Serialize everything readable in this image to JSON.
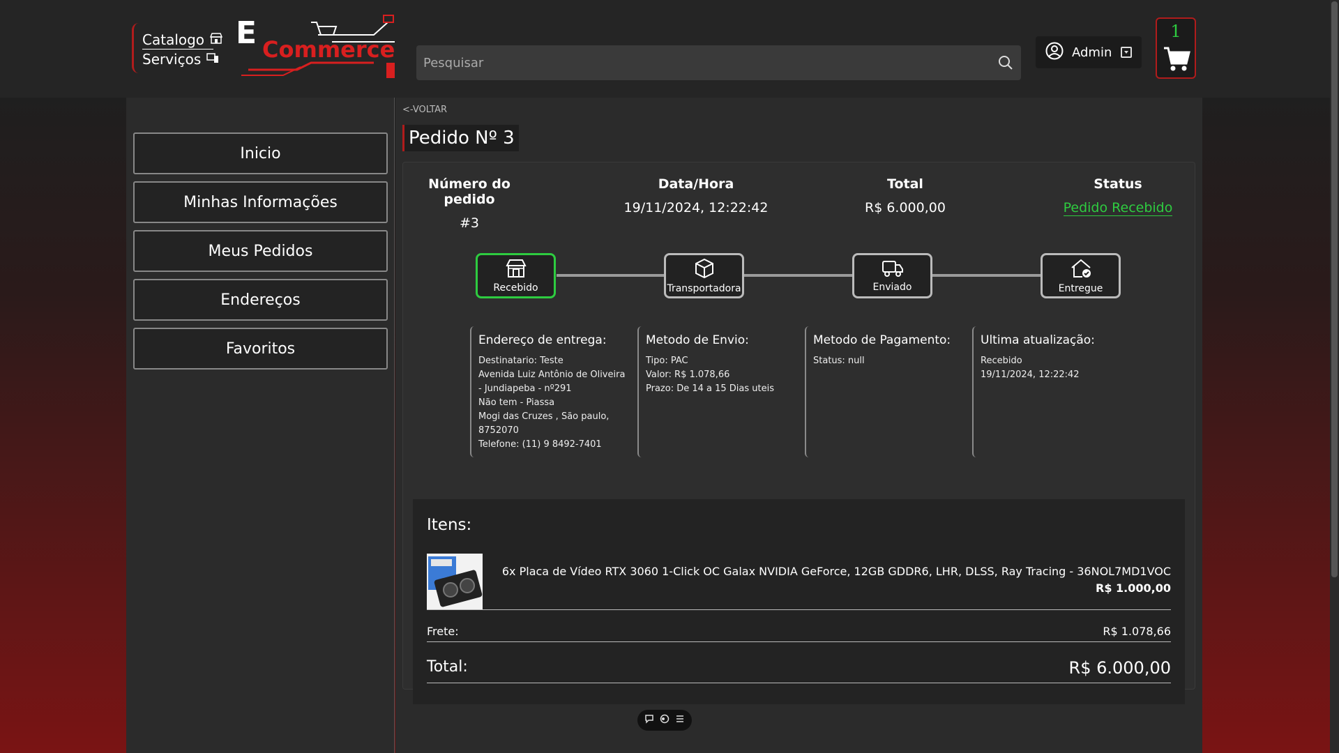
{
  "header": {
    "quicknav": [
      {
        "label": "Catalogo",
        "icon": "store-icon"
      },
      {
        "label": "Serviços",
        "icon": "devices-icon"
      }
    ],
    "logo": {
      "big_letter": "E",
      "word": "Commerce"
    },
    "search": {
      "placeholder": "Pesquisar",
      "value": ""
    },
    "user": {
      "label": "Admin"
    },
    "cart": {
      "count": "1"
    }
  },
  "sidebar": {
    "items": [
      {
        "label": "Inicio"
      },
      {
        "label": "Minhas Informações"
      },
      {
        "label": "Meus Pedidos"
      },
      {
        "label": "Endereços"
      },
      {
        "label": "Favoritos"
      }
    ]
  },
  "main": {
    "back_label": "<-VOLTAR",
    "title": "Pedido Nº 3",
    "summary": {
      "order_number": {
        "label": "Número do pedido",
        "value": "#3"
      },
      "datetime": {
        "label": "Data/Hora",
        "value": "19/11/2024, 12:22:42"
      },
      "total": {
        "label": "Total",
        "value": "R$ 6.000,00"
      },
      "status": {
        "label": "Status",
        "value": "Pedido Recebido"
      }
    },
    "steps": [
      {
        "label": "Recebido",
        "icon": "store-icon",
        "active": true
      },
      {
        "label": "Transportadora",
        "icon": "box-icon",
        "active": false
      },
      {
        "label": "Enviado",
        "icon": "truck-icon",
        "active": false
      },
      {
        "label": "Entregue",
        "icon": "home-check-icon",
        "active": false
      }
    ],
    "info": {
      "delivery": {
        "title": "Endereço de entrega:",
        "lines": [
          "Destinatario: Teste",
          "Avenida Luiz Antônio de Oliveira",
          "- Jundiapeba - nº291",
          "Não tem - Piassa",
          "Mogi das Cruzes , São paulo,",
          "8752070",
          "Telefone: (11) 9 8492-7401"
        ]
      },
      "shipping": {
        "title": "Metodo de Envio:",
        "lines": [
          "Tipo: PAC",
          "Valor: R$ 1.078,66",
          "Prazo: De 14 a 15 Dias uteis"
        ]
      },
      "payment": {
        "title": "Metodo de Pagamento:",
        "lines": [
          "Status: null"
        ]
      },
      "update": {
        "title": "Ultima atualização:",
        "lines": [
          "Recebido",
          "19/11/2024, 12:22:42"
        ]
      }
    },
    "items": {
      "title": "Itens:",
      "list": [
        {
          "name": "6x Placa de Vídeo RTX 3060 1-Click OC Galax NVIDIA GeForce, 12GB GDDR6, LHR, DLSS, Ray Tracing - 36NOL7MD1VOC",
          "price": "R$ 1.000,00"
        }
      ],
      "frete_label": "Frete:",
      "frete_value": "R$ 1.078,66",
      "total_label": "Total:",
      "total_value": "R$ 6.000,00"
    }
  },
  "colors": {
    "accent": "#b01c1c",
    "success": "#2ecc40",
    "surface": "#2b2b2b"
  }
}
